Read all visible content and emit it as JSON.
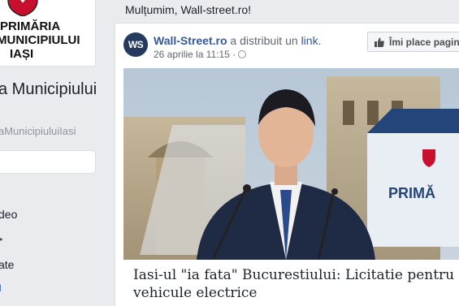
{
  "sidebar": {
    "logo_lines": [
      "PRIMĂRIA",
      "MUNICIPIULUI",
      "IAȘI"
    ],
    "page_name": "a Municipiului",
    "page_handle": "aMunicipiuluiIasi",
    "links": [
      "deo",
      "ate"
    ],
    "ticks": [
      "•",
      "l"
    ]
  },
  "post": {
    "intro_text": "Mulțumim, Wall-street.ro!",
    "avatar_initials": "WS",
    "author": "Wall-Street.ro",
    "action": " a distribuit un ",
    "link_word": "link",
    "period": ".",
    "timestamp": "26 aprilie la 11:15 ·",
    "like_label": "Îmi place pagina",
    "link_title": "Iasi-ul \"ia fata\" Bucurestiului: Licitatie pentru vehicule electrice",
    "image_sign_text": "PRIMĂ"
  },
  "colors": {
    "facebook_blue": "#365899",
    "background": "#e9ebee",
    "crest_red": "#c8102e"
  }
}
